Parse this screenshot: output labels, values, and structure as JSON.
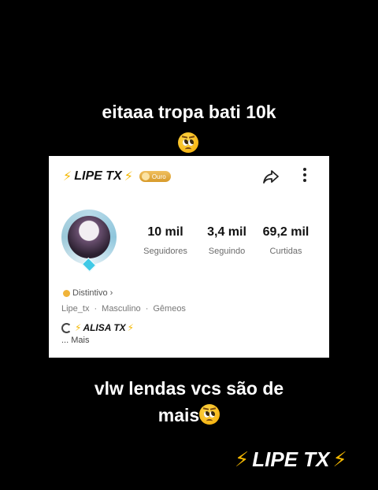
{
  "caption_top": "eitaaa tropa bati 10k",
  "profile": {
    "username": "LIPE TX",
    "bolt_symbol": "⚡",
    "badge_label": "Ouro",
    "stats": [
      {
        "value": "10 mil",
        "label": "Seguidores"
      },
      {
        "value": "3,4 mil",
        "label": "Seguindo"
      },
      {
        "value": "69,2 mil",
        "label": "Curtidas"
      }
    ],
    "distintivo": "Distintivo",
    "distintivo_arrow": "›",
    "meta": {
      "handle": "Lipe_tx",
      "gender": "Masculino",
      "sign": "Gêmeos",
      "separator": "·"
    },
    "linked_account": "ALISA TX",
    "more_label": "... Mais"
  },
  "caption_bottom_line1": "vlw lendas vcs são de",
  "caption_bottom_line2": "mais",
  "watermark": "LIPE TX",
  "icons": [
    "pleading-face-emoji-icon",
    "share-icon",
    "more-vertical-icon",
    "coin-icon",
    "bolt-icon"
  ],
  "colors": {
    "bolt": "#f5b800",
    "badge": "#d79a2a",
    "background": "#000000",
    "card": "#ffffff"
  }
}
